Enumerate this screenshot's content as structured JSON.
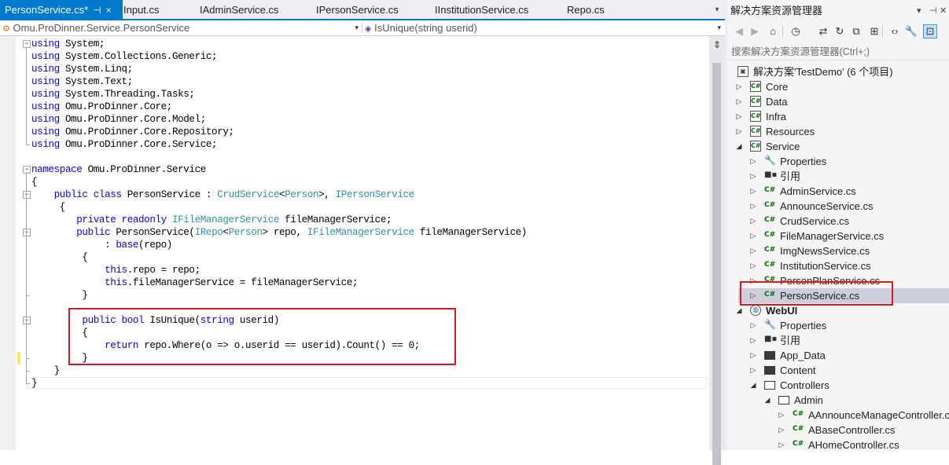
{
  "tabs": [
    {
      "label": "PersonService.cs*",
      "pin": "⊣",
      "close": "×",
      "active": true
    },
    {
      "label": "Input.cs"
    },
    {
      "label": "IAdminService.cs"
    },
    {
      "label": "IPersonService.cs"
    },
    {
      "label": "IInstitutionService.cs"
    },
    {
      "label": "Repo.cs"
    }
  ],
  "tab_overflow_icon": "▾",
  "navbar": {
    "type_selector": "Omu.ProDinner.Service.PersonService",
    "member_selector": "IsUnique(string userid)"
  },
  "editor": {
    "code_lines": [
      "using System;",
      "using System.Collections.Generic;",
      "using System.Linq;",
      "using System.Text;",
      "using System.Threading.Tasks;",
      "using Omu.ProDinner.Core;",
      "using Omu.ProDinner.Core.Model;",
      "using Omu.ProDinner.Core.Repository;",
      "using Omu.ProDinner.Core.Service;",
      "",
      "namespace Omu.ProDinner.Service",
      "{",
      "    public class PersonService : CrudService<Person>, IPersonService",
      "     {",
      "        private readonly IFileManagerService fileManagerService;",
      "        public PersonService(IRepo<Person> repo, IFileManagerService fileManagerService)",
      "             : base(repo)",
      "         {",
      "             this.repo = repo;",
      "             this.fileManagerService = fileManagerService;",
      "         }",
      "",
      "         public bool IsUnique(string userid)",
      "         {",
      "             return repo.Where(o => o.userid == userid).Count() == 0;",
      "         }",
      "    }",
      "}"
    ],
    "keywords": [
      "using",
      "namespace",
      "public",
      "class",
      "private",
      "readonly",
      "string",
      "bool",
      "return",
      "this",
      "base"
    ],
    "type_names": [
      "CrudService",
      "Person",
      "IPersonService",
      "IFileManagerService",
      "IRepo"
    ]
  },
  "colors": {
    "accent": "#007acc",
    "keyword": "#0000ff",
    "type": "#2b91af",
    "highlight_box": "#e01818",
    "selected_row": "#cccedb"
  },
  "solution_explorer": {
    "title": "解决方案资源管理器",
    "title_controls": [
      "▾",
      "📌",
      "✕"
    ],
    "search_placeholder": "搜索解决方案资源管理器(Ctrl+;)",
    "toolbar_icons": [
      "back-icon",
      "forward-icon",
      "home-icon",
      "history-icon",
      "sync-icon",
      "refresh-icon",
      "collapse-all-icon",
      "show-all-files-icon",
      "view-code-icon",
      "properties-icon",
      "preview-icon"
    ],
    "tree": [
      {
        "label": "解决方案'TestDemo' (6 个项目)",
        "icon": "solution",
        "indent": 0,
        "expander": ""
      },
      {
        "label": "Core",
        "icon": "csproj",
        "indent": 0,
        "expander": "▷"
      },
      {
        "label": "Data",
        "icon": "csproj",
        "indent": 0,
        "expander": "▷"
      },
      {
        "label": "Infra",
        "icon": "csproj",
        "indent": 0,
        "expander": "▷"
      },
      {
        "label": "Resources",
        "icon": "csproj",
        "indent": 0,
        "expander": "▷"
      },
      {
        "label": "Service",
        "icon": "csproj",
        "indent": 0,
        "expander": "◢"
      },
      {
        "label": "Properties",
        "icon": "wrench",
        "indent": 1,
        "expander": "▷"
      },
      {
        "label": "引用",
        "icon": "references",
        "indent": 1,
        "expander": "▷"
      },
      {
        "label": "AdminService.cs",
        "icon": "cs",
        "indent": 1,
        "expander": "▷"
      },
      {
        "label": "AnnounceService.cs",
        "icon": "cs",
        "indent": 1,
        "expander": "▷"
      },
      {
        "label": "CrudService.cs",
        "icon": "cs",
        "indent": 1,
        "expander": "▷"
      },
      {
        "label": "FileManagerService.cs",
        "icon": "cs",
        "indent": 1,
        "expander": "▷"
      },
      {
        "label": "ImgNewsService.cs",
        "icon": "cs",
        "indent": 1,
        "expander": "▷"
      },
      {
        "label": "InstitutionService.cs",
        "icon": "cs",
        "indent": 1,
        "expander": "▷"
      },
      {
        "label": "PersonPlanService.cs",
        "icon": "cs",
        "indent": 1,
        "expander": "▷"
      },
      {
        "label": "PersonService.cs",
        "icon": "cs",
        "indent": 1,
        "expander": "▷",
        "selected": true
      },
      {
        "label": "WebUI",
        "icon": "webproj",
        "indent": 0,
        "expander": "◢",
        "bold": true
      },
      {
        "label": "Properties",
        "icon": "wrench",
        "indent": 1,
        "expander": "▷"
      },
      {
        "label": "引用",
        "icon": "references",
        "indent": 1,
        "expander": "▷"
      },
      {
        "label": "App_Data",
        "icon": "folder",
        "indent": 1,
        "expander": "▷"
      },
      {
        "label": "Content",
        "icon": "folder",
        "indent": 1,
        "expander": "▷"
      },
      {
        "label": "Controllers",
        "icon": "folder-open",
        "indent": 1,
        "expander": "◢"
      },
      {
        "label": "Admin",
        "icon": "folder-open",
        "indent": 2,
        "expander": "◢"
      },
      {
        "label": "AAnnounceManageController.cs",
        "icon": "cs",
        "indent": 3,
        "expander": "▷"
      },
      {
        "label": "ABaseController.cs",
        "icon": "cs",
        "indent": 3,
        "expander": "▷"
      },
      {
        "label": "AHomeController.cs",
        "icon": "cs",
        "indent": 3,
        "expander": "▷"
      }
    ]
  }
}
